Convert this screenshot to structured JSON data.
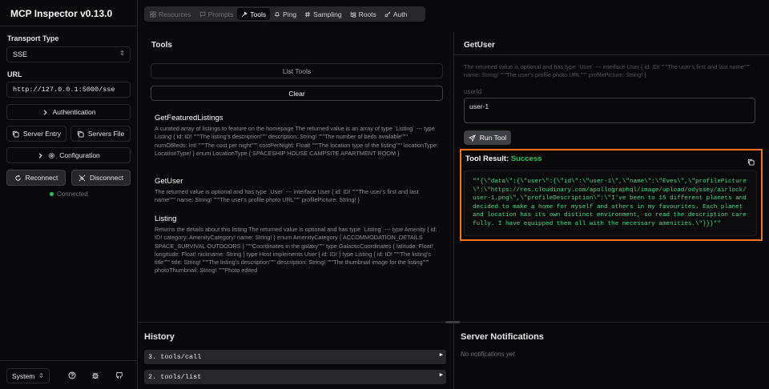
{
  "app": {
    "title": "MCP Inspector v0.13.0"
  },
  "sidebar": {
    "transport_label": "Transport Type",
    "transport_value": "SSE",
    "url_label": "URL",
    "url_value": "http://127.0.0.1:5000/sse",
    "authentication_label": "Authentication",
    "server_entry_label": "Server Entry",
    "servers_file_label": "Servers File",
    "configuration_label": "Configuration",
    "reconnect_label": "Reconnect",
    "disconnect_label": "Disconnect",
    "status_text": "Connected",
    "status_color": "#22c55e",
    "theme_value": "System"
  },
  "tabs": [
    {
      "label": "Resources",
      "icon": "resources-icon",
      "state": "disabled"
    },
    {
      "label": "Prompts",
      "icon": "prompts-icon",
      "state": "disabled"
    },
    {
      "label": "Tools",
      "icon": "tools-icon",
      "state": "active"
    },
    {
      "label": "Ping",
      "icon": "bell-icon",
      "state": "enabled"
    },
    {
      "label": "Sampling",
      "icon": "hash-icon",
      "state": "enabled"
    },
    {
      "label": "Roots",
      "icon": "folder-tree-icon",
      "state": "enabled"
    },
    {
      "label": "Auth",
      "icon": "key-icon",
      "state": "enabled"
    }
  ],
  "tools_panel": {
    "title": "Tools",
    "list_tools_label": "List Tools",
    "clear_label": "Clear",
    "tools": [
      {
        "name": "GetFeaturedListings",
        "description": "A curated array of listings to feature on the homepage The returned value is an array of type `Listing` --- type Listing { id: ID! \"\"\"The listing's description\"\"\" description: String! \"\"\"The number of beds available\"\"\" numOfBeds: Int! \"\"\"The cost per night\"\"\" costPerNight: Float! \"\"\"The location type of the listing\"\"\" locationType: LocationType! } enum LocationType { SPACESHIP HOUSE CAMPSITE APARTMENT ROOM }"
      },
      {
        "name": "GetUser",
        "description": "The returned value is optional and has type `User` --- interface User { id: ID! \"\"\"The user's first and last name\"\"\" name: String! \"\"\"The user's profile photo URL\"\"\" profilePicture: String! }"
      },
      {
        "name": "Listing",
        "description": "Returns the details about this listing The returned value is optional and has type `Listing` --- type Amenity { id: ID! category: AmenityCategory! name: String! } enum AmenityCategory { ACCOMMODATION_DETAILS SPACE_SURVIVAL OUTDOORS } \"\"\"Coordinates in the galaxy\"\"\" type GalacticCoordinates { latitude: Float! longitude: Float! nickname: String } type Host implements User { id: ID! } type Listing { id: ID! \"\"\"The listing's title\"\"\" title: String! \"\"\"The listing's description\"\"\" description: String! \"\"\"The thumbnail image for the listing\"\"\" photoThumbnail: String! \"\"\"Photo edited"
      }
    ]
  },
  "tool_detail": {
    "title": "GetUser",
    "description": "The returned value is optional and has type `User` --- interface User { id: ID! \"\"\"The user's first and last name\"\"\" name: String! \"\"\"The user's profile photo URL\"\"\" profilePicture: String! }",
    "param_label": "userId",
    "param_value": "user-1",
    "run_label": "Run Tool",
    "result_label": "Tool Result:",
    "result_status": "Success",
    "result_text": "\"\"{\\\"data\\\":{\\\"user\\\":{\\\"id\\\":\\\"user-1\\\",\\\"name\\\":\\\"Eves\\\",\\\"profilePicture\\\":\\\"https://res.cloudinary.com/apollographql/image/upload/odyssey/airlock/user-1.png\\\",\\\"profileDescription\\\":\\\"I've been to 15 different planets and decided to make a home for myself and others in my favourites. Each planet and location has its own distinct environment, so read the description carefully. I have equipped them all with the necessary amenities.\\\"}}}\"\"",
    "highlight_color": "#f97316"
  },
  "history": {
    "title": "History",
    "items": [
      "3. tools/call",
      "2. tools/list"
    ]
  },
  "notifications": {
    "title": "Server Notifications",
    "empty_text": "No notifications yet"
  }
}
